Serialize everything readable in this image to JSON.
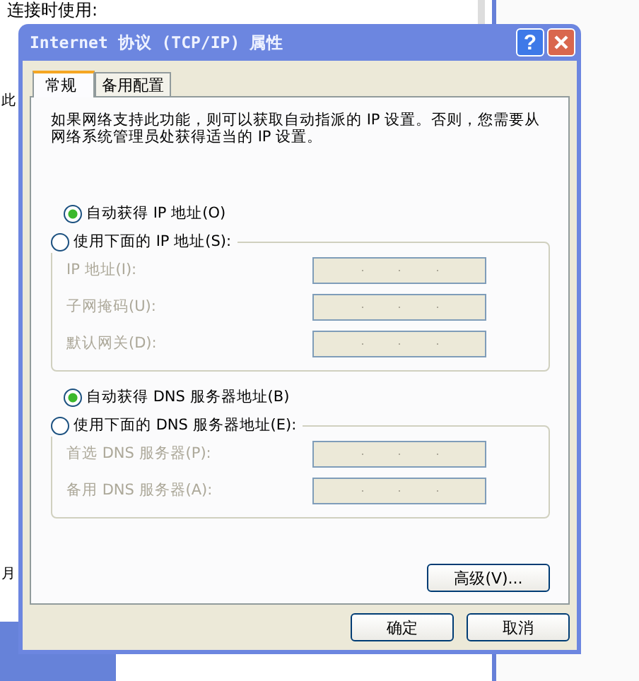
{
  "background_window": {
    "label": "连接时使用:",
    "label_2": "此",
    "label_3": "月"
  },
  "dialog": {
    "title": "Internet 协议 (TCP/IP) 属性",
    "help": "?",
    "tabs": [
      {
        "label": "常规",
        "selected": true
      },
      {
        "label": "备用配置",
        "selected": false
      }
    ],
    "description": "如果网络支持此功能，则可以获取自动指派的 IP 设置。否则，您需要从网络系统管理员处获得适当的 IP 设置。",
    "sections": [
      {
        "auto_option": {
          "label": "自动获得 IP 地址(O)",
          "selected": true
        },
        "manual_option": {
          "label": "使用下面的 IP 地址(S):",
          "selected": false
        },
        "fields": [
          {
            "label": "IP 地址(I):",
            "disabled": true
          },
          {
            "label": "子网掩码(U):",
            "disabled": true
          },
          {
            "label": "默认网关(D):",
            "disabled": true
          }
        ]
      },
      {
        "auto_option": {
          "label": "自动获得 DNS 服务器地址(B)",
          "selected": true
        },
        "manual_option": {
          "label": "使用下面的 DNS 服务器地址(E):",
          "selected": false
        },
        "fields": [
          {
            "label": "首选 DNS 服务器(P):",
            "disabled": true
          },
          {
            "label": "备用 DNS 服务器(A):",
            "disabled": true
          }
        ]
      }
    ],
    "advanced_button": "高级(V)...",
    "buttons": [
      "确定",
      "取消"
    ]
  }
}
